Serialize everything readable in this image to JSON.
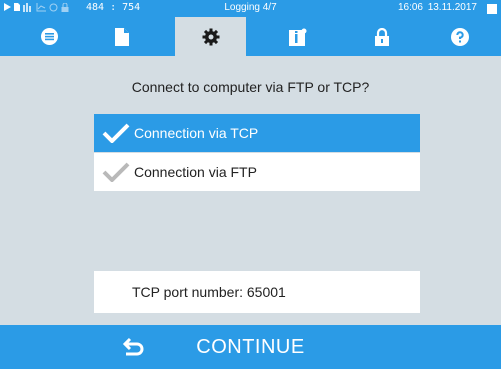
{
  "colors": {
    "accent": "#2b9be6",
    "background": "#d4dde3",
    "white": "#ffffff"
  },
  "statusbar": {
    "icons": [
      "play-icon",
      "card-icon",
      "temperature-icon",
      "chart-icon",
      "record-icon",
      "lock-icon"
    ],
    "coordinates": "484 : 754",
    "title": "Logging 4/7",
    "time": "16:06",
    "date": "13.11.2017"
  },
  "tabs": [
    {
      "name": "menu",
      "icon": "list-icon",
      "active": false
    },
    {
      "name": "document",
      "icon": "document-icon",
      "active": false
    },
    {
      "name": "settings",
      "icon": "gear-icon",
      "active": true
    },
    {
      "name": "info",
      "icon": "info-icon",
      "active": false
    },
    {
      "name": "lock",
      "icon": "lock-icon",
      "active": false
    },
    {
      "name": "help",
      "icon": "help-icon",
      "active": false
    }
  ],
  "main": {
    "question": "Connect to computer via FTP or TCP?",
    "options": [
      {
        "label": "Connection via TCP",
        "selected": true
      },
      {
        "label": "Connection via FTP",
        "selected": false
      }
    ],
    "port_label": "TCP port number: 65001"
  },
  "bottom": {
    "continue_label": "CONTINUE",
    "back_icon": "back-arrow-icon"
  }
}
